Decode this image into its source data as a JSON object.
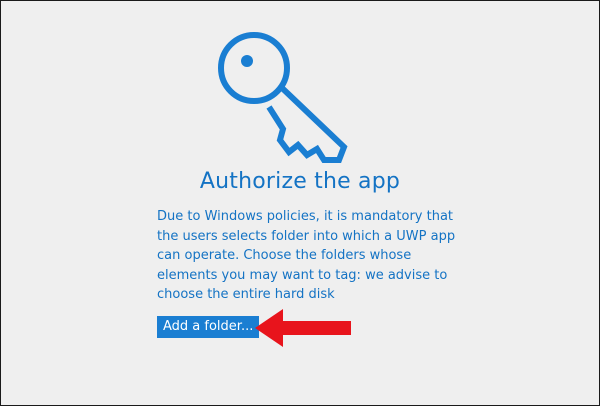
{
  "icon": "key-icon",
  "title": "Authorize the app",
  "description": "Due to Windows policies, it is mandatory that the users selects folder into which a UWP app can operate. Choose the folders whose elements you may want to tag: we advise to choose the entire hard disk",
  "button_label": "Add a folder...",
  "colors": {
    "accent": "#1473c4",
    "button_bg": "#1a7ed2",
    "background": "#efefef",
    "annotation_arrow": "#e8141c"
  }
}
